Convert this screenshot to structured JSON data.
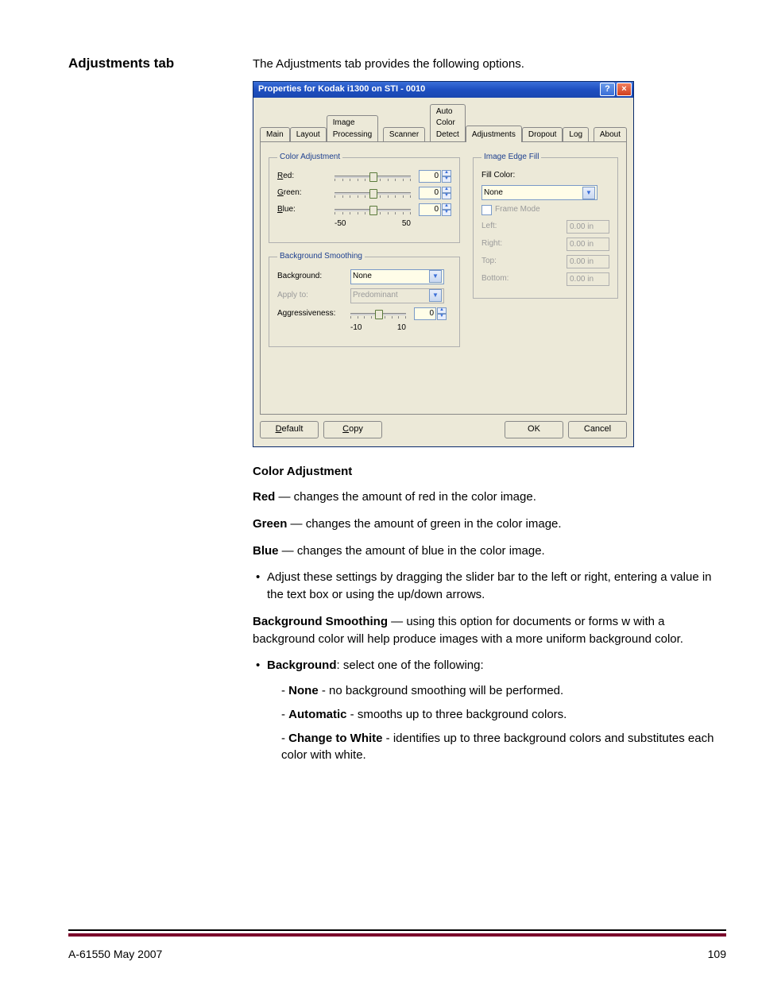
{
  "heading": "Adjustments tab",
  "intro": "The Adjustments tab provides the following options.",
  "dialog": {
    "title": "Properties for Kodak i1300 on STI - 0010",
    "tabs": {
      "main": "Main",
      "layout": "Layout",
      "image_processing": "Image Processing",
      "scanner": "Scanner",
      "auto_color_detect": "Auto Color Detect",
      "adjustments": "Adjustments",
      "dropout": "Dropout",
      "log": "Log",
      "about": "About"
    },
    "color_adjustment": {
      "legend": "Color Adjustment",
      "red_label": "Red:",
      "green_label": "Green:",
      "blue_label": "Blue:",
      "value": "0",
      "range_min": "-50",
      "range_max": "50"
    },
    "bg_smoothing": {
      "legend": "Background Smoothing",
      "background_label": "Background:",
      "background_value": "None",
      "applyto_label": "Apply to:",
      "applyto_value": "Predominant",
      "aggr_label": "Aggressiveness:",
      "aggr_value": "0",
      "range_min": "-10",
      "range_max": "10"
    },
    "edge_fill": {
      "legend": "Image Edge Fill",
      "fillcolor_label": "Fill Color:",
      "fillcolor_value": "None",
      "framemode_label": "Frame Mode",
      "left_label": "Left:",
      "right_label": "Right:",
      "top_label": "Top:",
      "bottom_label": "Bottom:",
      "value": "0.00 in"
    },
    "buttons": {
      "default": "Default",
      "copy": "Copy",
      "ok": "OK",
      "cancel": "Cancel"
    }
  },
  "body": {
    "h_color_adjustment": "Color Adjustment",
    "red_b": "Red",
    "red_t": " — changes the amount of red in the color image.",
    "green_b": "Green",
    "green_t": " — changes the amount of green in the color image.",
    "blue_b": "Blue",
    "blue_t": " — changes the amount of blue in the color image.",
    "adjust_bullet": "Adjust these settings by dragging the slider bar to the left or right, entering a value in the text box or using the up/down arrows.",
    "bgsmooth_b": "Background Smoothing",
    "bgsmooth_t": " — using this option for documents or forms w with a background color will help produce images with a more uniform background color.",
    "bg_b": "Background",
    "bg_t": ": select one of the following:",
    "none_b": "None",
    "none_t": " - no background smoothing will be performed.",
    "auto_b": "Automatic",
    "auto_t": " - smooths up to three background colors.",
    "ctw_b": "Change to White",
    "ctw_t": " - identifies up to three background colors and substitutes each color with white."
  },
  "footer": {
    "left": "A-61550  May 2007",
    "right": "109"
  }
}
